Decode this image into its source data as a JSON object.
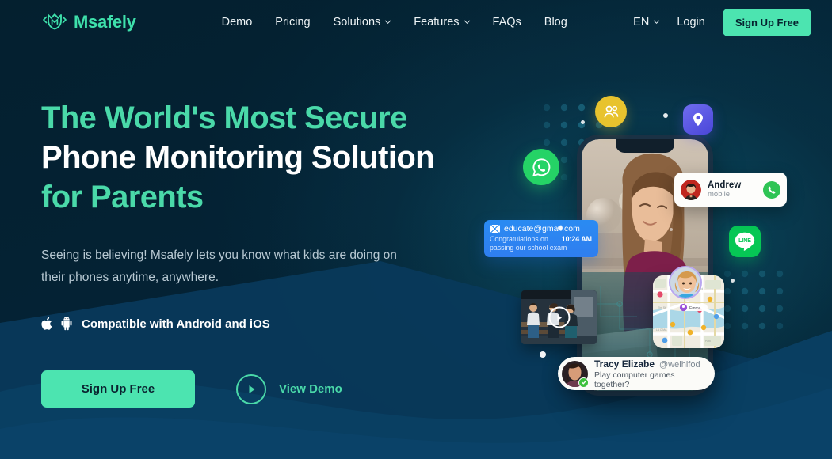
{
  "brand": {
    "name": "Msafely",
    "logo_icon": "msafely-shield-m-icon",
    "accent_green": "#4ce4b0",
    "accent_teal": "#4ad9a9",
    "bg_dark": "#04202f",
    "wave_blue": "#0a3f63"
  },
  "header": {
    "nav": [
      {
        "label": "Demo",
        "has_caret": false,
        "icon": ""
      },
      {
        "label": "Pricing",
        "has_caret": false,
        "icon": ""
      },
      {
        "label": "Solutions",
        "has_caret": true,
        "icon": "chevron-down-icon"
      },
      {
        "label": "Features",
        "has_caret": true,
        "icon": "chevron-down-icon"
      },
      {
        "label": "FAQs",
        "has_caret": false,
        "icon": ""
      },
      {
        "label": "Blog",
        "has_caret": false,
        "icon": ""
      }
    ],
    "language": "EN",
    "language_caret_icon": "chevron-down-icon",
    "login_label": "Login",
    "signup_label": "Sign Up Free"
  },
  "hero": {
    "headline_line1": "The World's Most Secure",
    "headline_line2": "Phone Monitoring Solution",
    "headline_line3": "for Parents",
    "subtext": "Seeing is believing! Msafely lets you know what kids are doing on their phones anytime, anywhere.",
    "compat_label": "Compatible with Android and iOS",
    "compat_icons": [
      "apple-icon",
      "android-icon"
    ],
    "primary_cta": "Sign Up Free",
    "demo_cta": "View Demo",
    "demo_icon": "play-icon"
  },
  "illustration": {
    "app_icons": [
      {
        "name": "whatsapp-icon",
        "color": "#25d366"
      },
      {
        "name": "contacts-users-icon",
        "color": "#e8c32e"
      },
      {
        "name": "location-pin-icon",
        "color": "#5a56e6"
      },
      {
        "name": "line-app-icon",
        "color": "#06c755",
        "label": "LINE"
      }
    ],
    "contact_card": {
      "name": "Andrew",
      "subtitle": "mobile",
      "call_icon": "phone-call-icon",
      "avatar_icon": "contact-avatar"
    },
    "email_card": {
      "mail_icon": "envelope-icon",
      "address": "educate@gmail.com",
      "message": "Congratulations on passing our school exam",
      "time": "10:24 AM"
    },
    "gallery": {
      "play_icon": "play-icon"
    },
    "map_card": {
      "pin_label": "Emma",
      "pin_icon": "map-marker-icon",
      "kid_avatar": "kid-avatar"
    },
    "tracy_card": {
      "name": "Tracy Elizabe",
      "handle": "@weihifod",
      "message": "Play computer games together?",
      "verified_icon": "verified-check-icon",
      "avatar_icon": "tracy-avatar"
    }
  }
}
